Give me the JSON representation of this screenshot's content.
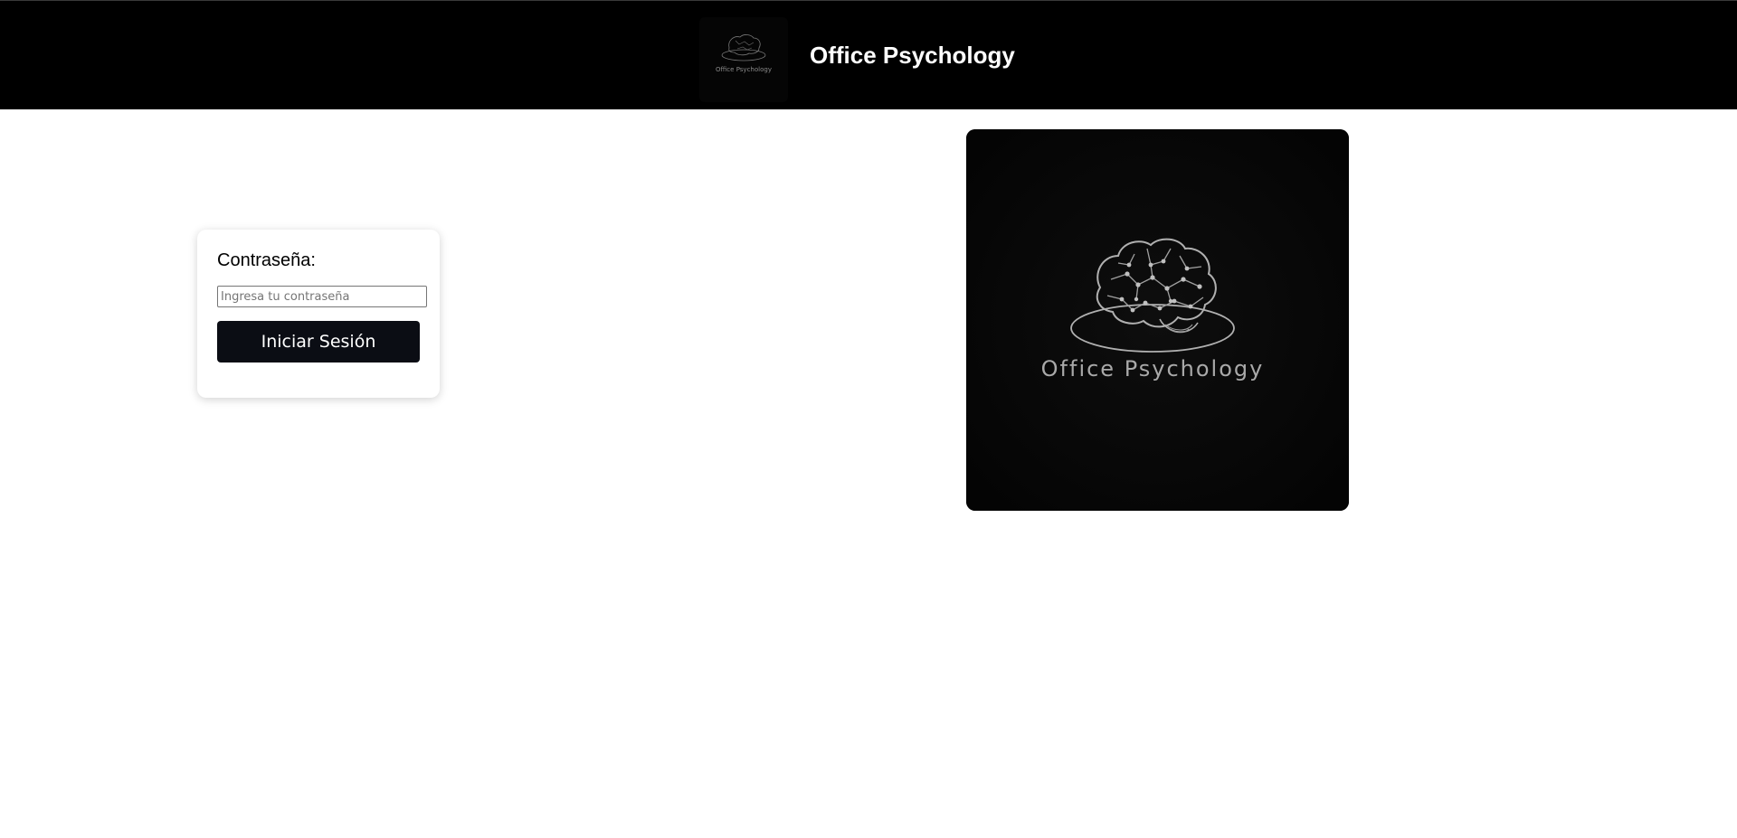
{
  "header": {
    "title": "Office Psychology",
    "logo_caption": "Office Psychology"
  },
  "login": {
    "password_label": "Contraseña:",
    "password_placeholder": "Ingresa tu contraseña",
    "password_value": "",
    "submit_label": "Iniciar Sesión"
  },
  "hero": {
    "caption": "Office Psychology"
  },
  "icons": {
    "logo": "brain-icon"
  },
  "colors": {
    "header_bg": "#000000",
    "button_bg": "#0b0d14",
    "hero_bg": "#060606",
    "logo_line": "#a9a9a9"
  }
}
